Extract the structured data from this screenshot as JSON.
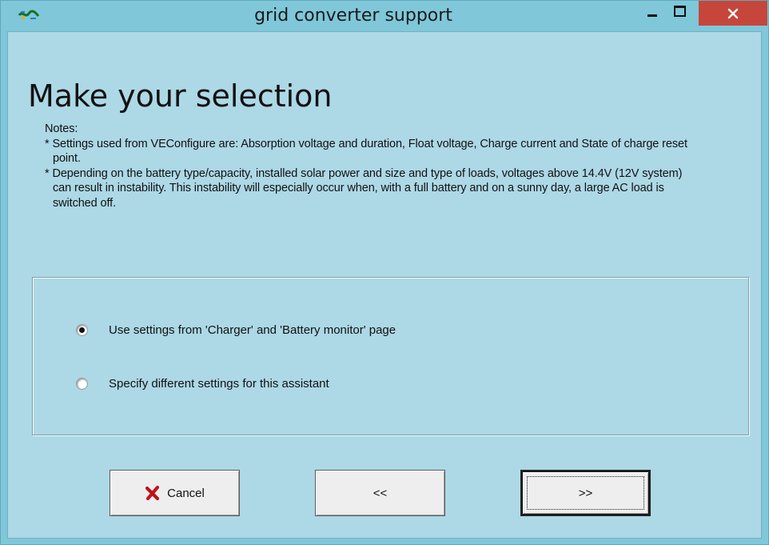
{
  "window": {
    "title": "grid converter support",
    "controls": {
      "minimize": "minimize",
      "maximize": "maximize",
      "close": "close"
    }
  },
  "page": {
    "heading": "Make your selection",
    "notes_title": "Notes:",
    "notes": [
      "* Settings used from VEConfigure are: Absorption voltage and duration, Float voltage, Charge current and State of charge reset point.",
      "* Depending on the battery type/capacity, installed solar power and size and type of loads, voltages above 14.4V (12V system) can result in instability. This instability will especially occur when, with a full battery and on a sunny day, a large AC load is switched off."
    ]
  },
  "options": [
    {
      "label": "Use settings from 'Charger' and 'Battery monitor' page",
      "selected": true
    },
    {
      "label": "Specify different settings for this assistant",
      "selected": false
    }
  ],
  "buttons": {
    "cancel": "Cancel",
    "back": "<<",
    "next": ">>"
  },
  "colors": {
    "window_frame": "#7fc7d9",
    "client_bg": "#add8e6",
    "close_button": "#c7463b",
    "cancel_x": "#c0161b"
  },
  "icons": {
    "app": "victron-app-icon",
    "close": "close-icon",
    "cancel": "red-x-icon"
  }
}
